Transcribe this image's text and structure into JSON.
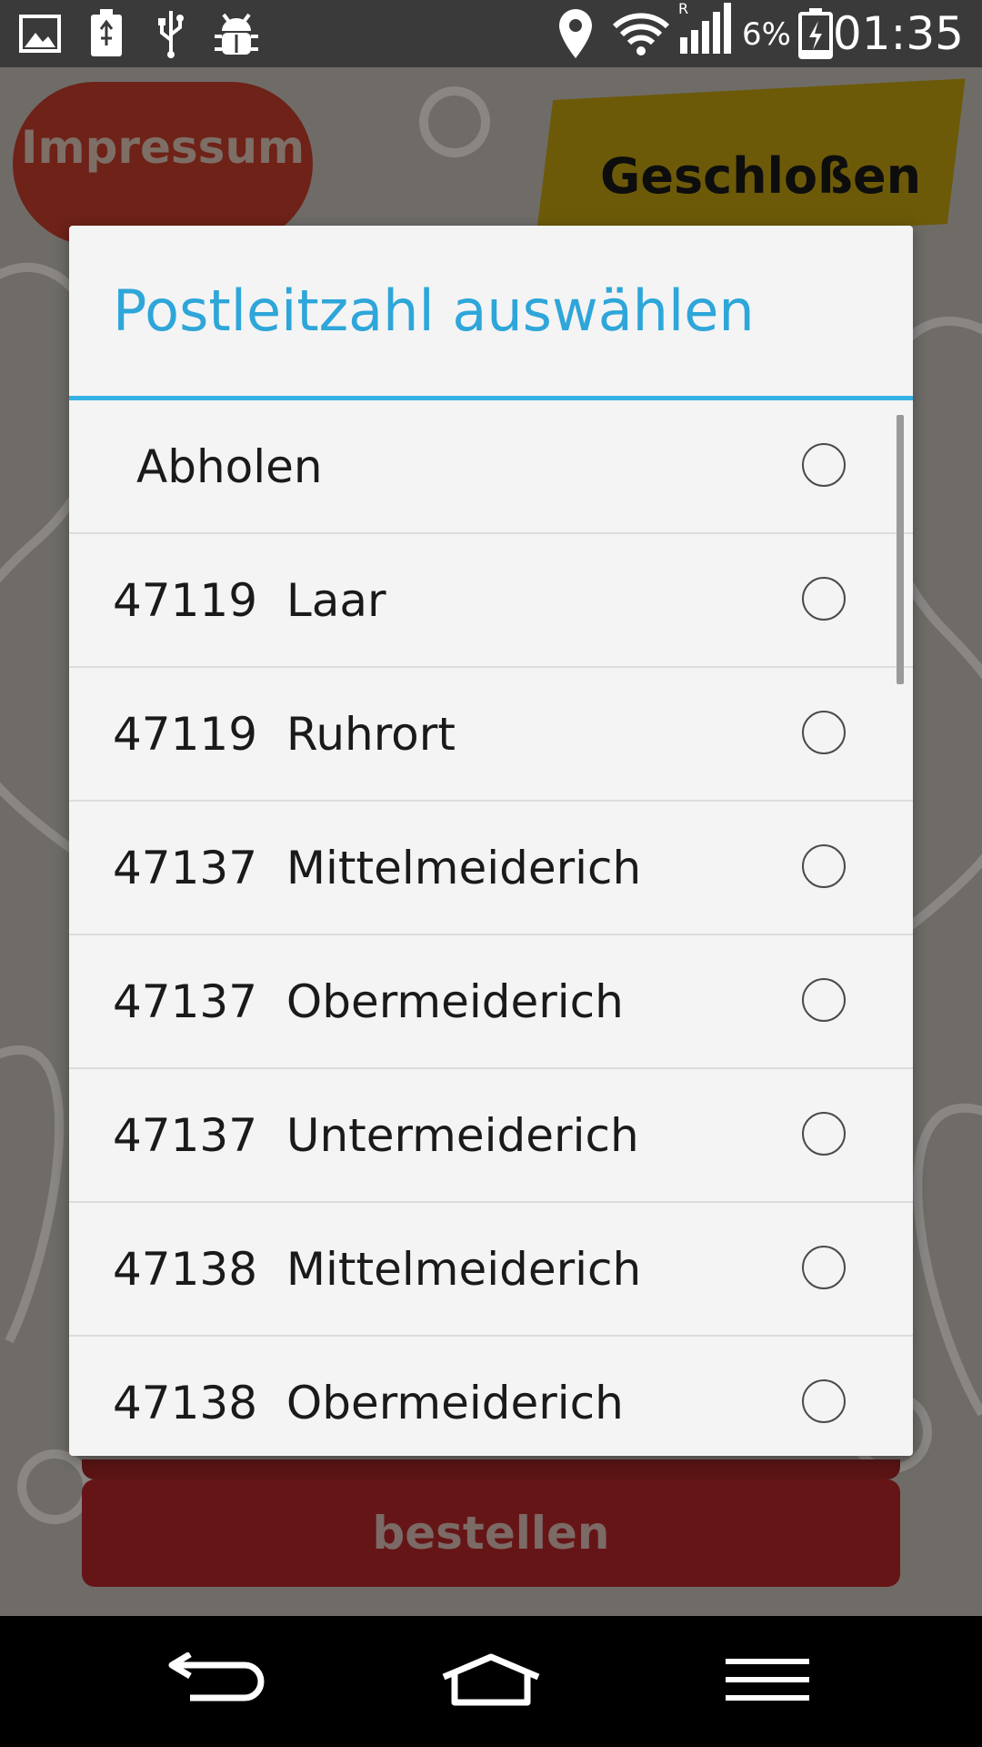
{
  "status_bar": {
    "time": "01:35",
    "battery_percent": "6%",
    "network_indicator": "R",
    "icons": [
      "image-icon",
      "battery-charging-icon",
      "usb-icon",
      "android-debug-icon",
      "location-pin-icon",
      "wifi-icon",
      "signal-icon",
      "battery-icon"
    ]
  },
  "app": {
    "impressum_label": "Impressum",
    "status_label": "Geschloßen",
    "order_label": "bestellen"
  },
  "dialog": {
    "title": "Postleitzahl auswählen",
    "accent_color": "#35b1e3",
    "options": [
      {
        "label": "Abholen",
        "selected": false
      },
      {
        "label": "47119  Laar",
        "selected": false
      },
      {
        "label": "47119  Ruhrort",
        "selected": false
      },
      {
        "label": "47137  Mittelmeiderich",
        "selected": false
      },
      {
        "label": "47137  Obermeiderich",
        "selected": false
      },
      {
        "label": "47137  Untermeiderich",
        "selected": false
      },
      {
        "label": "47138  Mittelmeiderich",
        "selected": false
      },
      {
        "label": "47138  Obermeiderich",
        "selected": false
      }
    ]
  },
  "nav_bar": {
    "buttons": [
      "back-icon",
      "home-icon",
      "menu-icon"
    ]
  }
}
